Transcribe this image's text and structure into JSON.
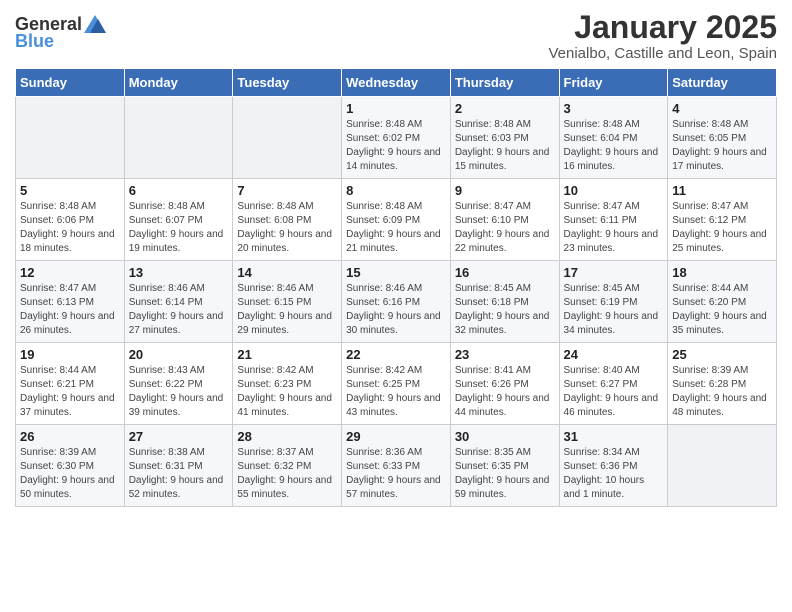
{
  "header": {
    "logo_general": "General",
    "logo_blue": "Blue",
    "title": "January 2025",
    "subtitle": "Venialbo, Castille and Leon, Spain"
  },
  "weekdays": [
    "Sunday",
    "Monday",
    "Tuesday",
    "Wednesday",
    "Thursday",
    "Friday",
    "Saturday"
  ],
  "weeks": [
    [
      {
        "day": "",
        "info": ""
      },
      {
        "day": "",
        "info": ""
      },
      {
        "day": "",
        "info": ""
      },
      {
        "day": "1",
        "info": "Sunrise: 8:48 AM\nSunset: 6:02 PM\nDaylight: 9 hours and 14 minutes."
      },
      {
        "day": "2",
        "info": "Sunrise: 8:48 AM\nSunset: 6:03 PM\nDaylight: 9 hours and 15 minutes."
      },
      {
        "day": "3",
        "info": "Sunrise: 8:48 AM\nSunset: 6:04 PM\nDaylight: 9 hours and 16 minutes."
      },
      {
        "day": "4",
        "info": "Sunrise: 8:48 AM\nSunset: 6:05 PM\nDaylight: 9 hours and 17 minutes."
      }
    ],
    [
      {
        "day": "5",
        "info": "Sunrise: 8:48 AM\nSunset: 6:06 PM\nDaylight: 9 hours and 18 minutes."
      },
      {
        "day": "6",
        "info": "Sunrise: 8:48 AM\nSunset: 6:07 PM\nDaylight: 9 hours and 19 minutes."
      },
      {
        "day": "7",
        "info": "Sunrise: 8:48 AM\nSunset: 6:08 PM\nDaylight: 9 hours and 20 minutes."
      },
      {
        "day": "8",
        "info": "Sunrise: 8:48 AM\nSunset: 6:09 PM\nDaylight: 9 hours and 21 minutes."
      },
      {
        "day": "9",
        "info": "Sunrise: 8:47 AM\nSunset: 6:10 PM\nDaylight: 9 hours and 22 minutes."
      },
      {
        "day": "10",
        "info": "Sunrise: 8:47 AM\nSunset: 6:11 PM\nDaylight: 9 hours and 23 minutes."
      },
      {
        "day": "11",
        "info": "Sunrise: 8:47 AM\nSunset: 6:12 PM\nDaylight: 9 hours and 25 minutes."
      }
    ],
    [
      {
        "day": "12",
        "info": "Sunrise: 8:47 AM\nSunset: 6:13 PM\nDaylight: 9 hours and 26 minutes."
      },
      {
        "day": "13",
        "info": "Sunrise: 8:46 AM\nSunset: 6:14 PM\nDaylight: 9 hours and 27 minutes."
      },
      {
        "day": "14",
        "info": "Sunrise: 8:46 AM\nSunset: 6:15 PM\nDaylight: 9 hours and 29 minutes."
      },
      {
        "day": "15",
        "info": "Sunrise: 8:46 AM\nSunset: 6:16 PM\nDaylight: 9 hours and 30 minutes."
      },
      {
        "day": "16",
        "info": "Sunrise: 8:45 AM\nSunset: 6:18 PM\nDaylight: 9 hours and 32 minutes."
      },
      {
        "day": "17",
        "info": "Sunrise: 8:45 AM\nSunset: 6:19 PM\nDaylight: 9 hours and 34 minutes."
      },
      {
        "day": "18",
        "info": "Sunrise: 8:44 AM\nSunset: 6:20 PM\nDaylight: 9 hours and 35 minutes."
      }
    ],
    [
      {
        "day": "19",
        "info": "Sunrise: 8:44 AM\nSunset: 6:21 PM\nDaylight: 9 hours and 37 minutes."
      },
      {
        "day": "20",
        "info": "Sunrise: 8:43 AM\nSunset: 6:22 PM\nDaylight: 9 hours and 39 minutes."
      },
      {
        "day": "21",
        "info": "Sunrise: 8:42 AM\nSunset: 6:23 PM\nDaylight: 9 hours and 41 minutes."
      },
      {
        "day": "22",
        "info": "Sunrise: 8:42 AM\nSunset: 6:25 PM\nDaylight: 9 hours and 43 minutes."
      },
      {
        "day": "23",
        "info": "Sunrise: 8:41 AM\nSunset: 6:26 PM\nDaylight: 9 hours and 44 minutes."
      },
      {
        "day": "24",
        "info": "Sunrise: 8:40 AM\nSunset: 6:27 PM\nDaylight: 9 hours and 46 minutes."
      },
      {
        "day": "25",
        "info": "Sunrise: 8:39 AM\nSunset: 6:28 PM\nDaylight: 9 hours and 48 minutes."
      }
    ],
    [
      {
        "day": "26",
        "info": "Sunrise: 8:39 AM\nSunset: 6:30 PM\nDaylight: 9 hours and 50 minutes."
      },
      {
        "day": "27",
        "info": "Sunrise: 8:38 AM\nSunset: 6:31 PM\nDaylight: 9 hours and 52 minutes."
      },
      {
        "day": "28",
        "info": "Sunrise: 8:37 AM\nSunset: 6:32 PM\nDaylight: 9 hours and 55 minutes."
      },
      {
        "day": "29",
        "info": "Sunrise: 8:36 AM\nSunset: 6:33 PM\nDaylight: 9 hours and 57 minutes."
      },
      {
        "day": "30",
        "info": "Sunrise: 8:35 AM\nSunset: 6:35 PM\nDaylight: 9 hours and 59 minutes."
      },
      {
        "day": "31",
        "info": "Sunrise: 8:34 AM\nSunset: 6:36 PM\nDaylight: 10 hours and 1 minute."
      },
      {
        "day": "",
        "info": ""
      }
    ]
  ]
}
